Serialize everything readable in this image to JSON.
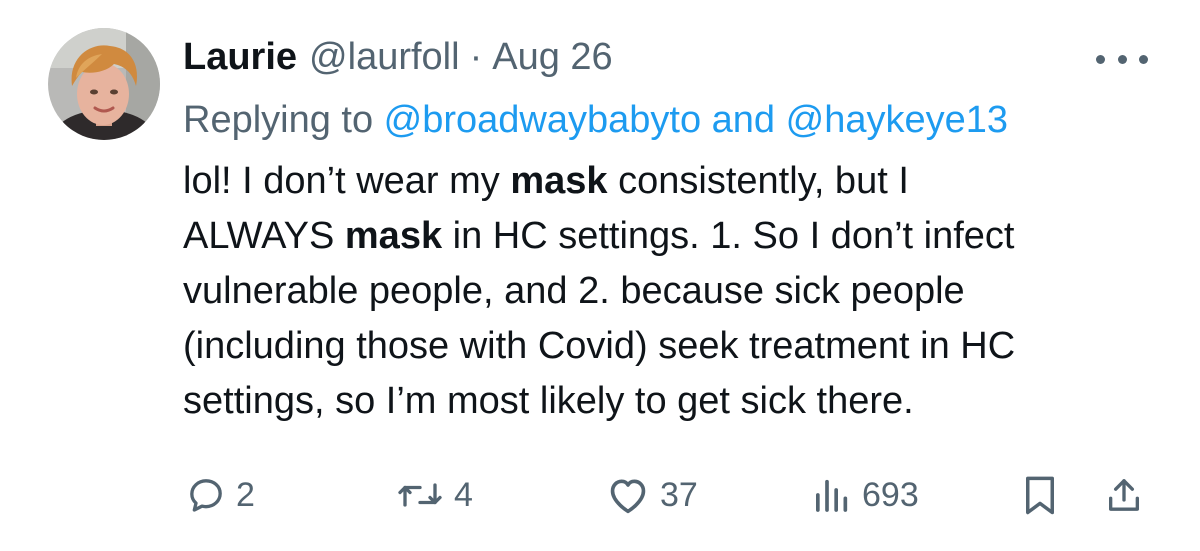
{
  "tweet": {
    "author": {
      "display_name": "Laurie",
      "handle": "@laurfoll",
      "avatar": "profile-photo"
    },
    "separator": "·",
    "date": "Aug 26",
    "reply": {
      "prefix": "Replying to ",
      "mention_1": "@broadwaybabyto",
      "conjunction": " and ",
      "mention_2": "@haykeye13"
    },
    "body_lines": [
      [
        "lol! I don’t wear my ",
        "mask",
        " consistently, but I"
      ],
      [
        "ALWAYS ",
        "mask",
        " in HC settings. 1. So I don’t infect"
      ],
      [
        "vulnerable people, and 2. because sick people"
      ],
      [
        "(including those with Covid) seek treatment in HC"
      ],
      [
        "settings, so I’m most likely to get sick there."
      ]
    ],
    "metrics": {
      "replies": "2",
      "reposts": "4",
      "likes": "37",
      "views": "693"
    },
    "icons": {
      "more": "more-icon",
      "reply": "reply-icon",
      "repost": "repost-icon",
      "like": "heart-icon",
      "views": "views-icon",
      "bookmark": "bookmark-icon",
      "share": "share-icon"
    },
    "colors": {
      "text": "#0f1419",
      "secondary": "#536471",
      "link": "#1d9bf0"
    }
  }
}
